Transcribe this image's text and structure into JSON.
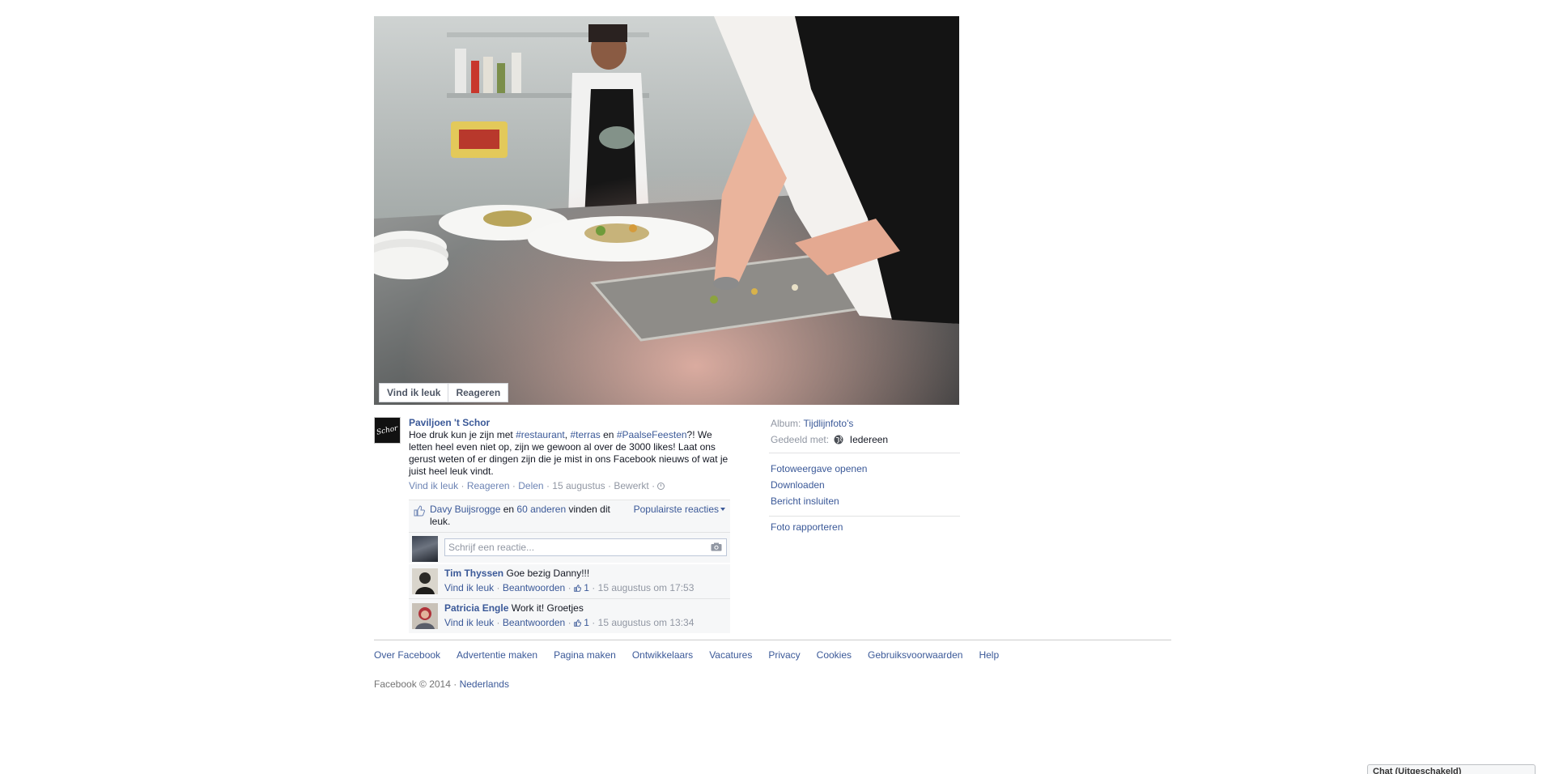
{
  "photo": {
    "like_button": "Vind ik leuk",
    "comment_button": "Reageren"
  },
  "post": {
    "page_name": "Paviljoen 't Schor",
    "avatar_logo_text": "Schor",
    "text_before": "Hoe druk kun je zijn met ",
    "tag_restaurant": "#restaurant",
    "sep_comma": ", ",
    "tag_terras": "#terras",
    "text_en": " en ",
    "tag_paalse": "#PaalseFeesten",
    "text_after": "?! We letten heel even niet op, zijn we gewoon al over de 3000 likes! Laat ons gerust weten of er dingen zijn die je mist in ons Facebook nieuws of wat je juist heel leuk vindt.",
    "meta": {
      "like": "Vind ik leuk",
      "comment": "Reageren",
      "share": "Delen",
      "date": "15 augustus",
      "edited": "Bewerkt"
    }
  },
  "ufi": {
    "liker_name": "Davy Buijsrogge",
    "likes_and": " en ",
    "others_link": "60 anderen",
    "likes_suffix": " vinden dit leuk.",
    "sort_label": "Populairste reacties",
    "comment_placeholder": "Schrijf een reactie...",
    "comments": [
      {
        "author": "Tim Thyssen",
        "text": "Goe bezig Danny!!!",
        "like": "Vind ik leuk",
        "reply": "Beantwoorden",
        "like_count": "1",
        "timestamp": "15 augustus om 17:53"
      },
      {
        "author": "Patricia Engle",
        "text": "Work it! Groetjes",
        "like": "Vind ik leuk",
        "reply": "Beantwoorden",
        "like_count": "1",
        "timestamp": "15 augustus om 13:34"
      }
    ]
  },
  "sidebar": {
    "album_label": "Album:",
    "album_value": "Tijdlijnfoto's",
    "shared_label": "Gedeeld met:",
    "shared_value": "Iedereen",
    "actions": [
      "Fotoweergave openen",
      "Downloaden",
      "Bericht insluiten"
    ],
    "report": "Foto rapporteren"
  },
  "footer": {
    "links": [
      "Over Facebook",
      "Advertentie maken",
      "Pagina maken",
      "Ontwikkelaars",
      "Vacatures",
      "Privacy",
      "Cookies",
      "Gebruiksvoorwaarden",
      "Help"
    ],
    "copyright": "Facebook © 2014 · ",
    "language": "Nederlands"
  },
  "chat": {
    "label": "Chat (Uitgeschakeld)"
  },
  "colors": {
    "link": "#3b5998",
    "muted": "#9197a3",
    "ufi_background": "#f6f7f8"
  }
}
